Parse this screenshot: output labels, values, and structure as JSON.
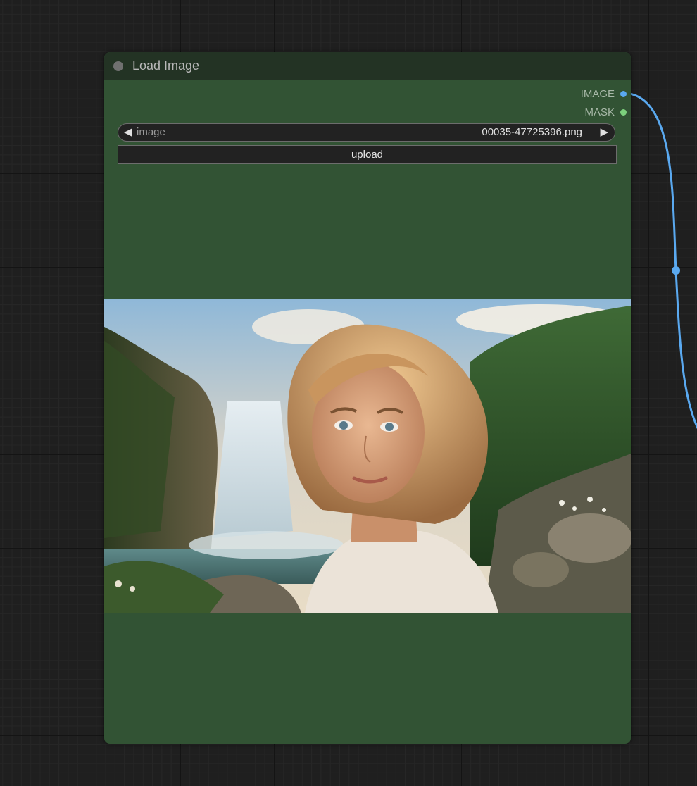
{
  "node": {
    "title": "Load Image",
    "outputs": [
      {
        "label": "IMAGE",
        "color": "#5aa9f0"
      },
      {
        "label": "MASK",
        "color": "#7cd07c"
      }
    ],
    "image_widget": {
      "label": "image",
      "value": "00035-47725396.png",
      "arrow_left": "◀",
      "arrow_right": "▶"
    },
    "upload_label": "upload",
    "header_color": "#233324",
    "body_color": "#325334"
  },
  "preview": {
    "icon": "image-preview"
  },
  "wire": {
    "color": "#5aa9f0"
  }
}
